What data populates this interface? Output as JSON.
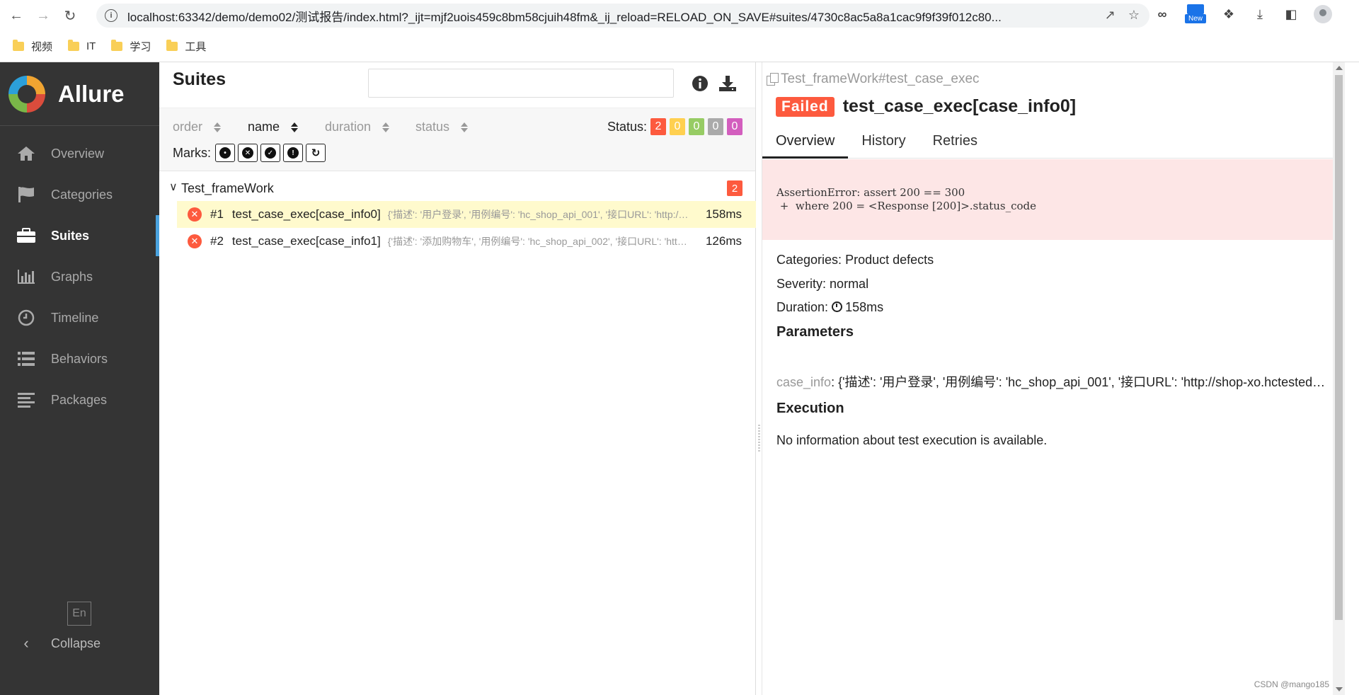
{
  "browser": {
    "url": "localhost:63342/demo/demo02/测试报告/index.html?_ijt=mjf2uois459c8bm58cjuih48fm&_ij_reload=RELOAD_ON_SAVE#suites/4730c8ac5a8a1cac9f9f39f012c80...",
    "new_badge": "New",
    "bookmarks": [
      {
        "label": "视频"
      },
      {
        "label": "IT"
      },
      {
        "label": "学习"
      },
      {
        "label": "工具"
      }
    ]
  },
  "sidebar": {
    "brand": "Allure",
    "items": [
      {
        "label": "Overview",
        "icon": "home-icon"
      },
      {
        "label": "Categories",
        "icon": "flag-icon"
      },
      {
        "label": "Suites",
        "icon": "briefcase-icon",
        "active": true
      },
      {
        "label": "Graphs",
        "icon": "bar-chart-icon"
      },
      {
        "label": "Timeline",
        "icon": "clock-icon"
      },
      {
        "label": "Behaviors",
        "icon": "list-icon"
      },
      {
        "label": "Packages",
        "icon": "align-left-icon"
      }
    ],
    "language": "En",
    "collapse_label": "Collapse"
  },
  "suites": {
    "title": "Suites",
    "search_placeholder": "",
    "sorters": [
      "order",
      "name",
      "duration",
      "status"
    ],
    "active_sorter": "name",
    "status_label": "Status:",
    "status_counts": [
      {
        "value": "2",
        "color": "#fd5a3e"
      },
      {
        "value": "0",
        "color": "#ffd050"
      },
      {
        "value": "0",
        "color": "#97cc64"
      },
      {
        "value": "0",
        "color": "#aaaaaa"
      },
      {
        "value": "0",
        "color": "#d35ebe"
      }
    ],
    "marks_label": "Marks:",
    "group": {
      "name": "Test_frameWork",
      "count": "2"
    },
    "tests": [
      {
        "num": "#1",
        "name": "test_case_exec[case_info0]",
        "params": "{'描述': '用户登录', '用例编号': 'hc_shop_api_001', '接口URL': 'http://shop-xo.hctestedu.com/index.php?s=api/user/login'",
        "duration": "158ms",
        "selected": true
      },
      {
        "num": "#2",
        "name": "test_case_exec[case_info1]",
        "params": "{'描述': '添加购物车', '用例编号': 'hc_shop_api_002', '接口URL': 'http://shop-xo.hctestedu.com/index.php'",
        "duration": "126ms",
        "selected": false
      }
    ]
  },
  "details": {
    "breadcrumb": "Test_frameWork#test_case_exec",
    "status_badge": "Failed",
    "title": "test_case_exec[case_info0]",
    "tabs": [
      "Overview",
      "History",
      "Retries"
    ],
    "active_tab": "Overview",
    "error_message": "AssertionError: assert 200 == 300\n +  where 200 = <Response [200]>.status_code",
    "categories_label": "Categories:",
    "categories_value": "Product defects",
    "severity_label": "Severity:",
    "severity_value": "normal",
    "duration_label": "Duration:",
    "duration_value": "158ms",
    "parameters_title": "Parameters",
    "param_name": "case_info",
    "param_value": "{'描述': '用户登录', '用例编号': 'hc_shop_api_001', '接口URL': 'http://shop-xo.hctestedu.c...",
    "execution_title": "Execution",
    "execution_text": "No information about test execution is available."
  },
  "watermark": "CSDN @mango185"
}
